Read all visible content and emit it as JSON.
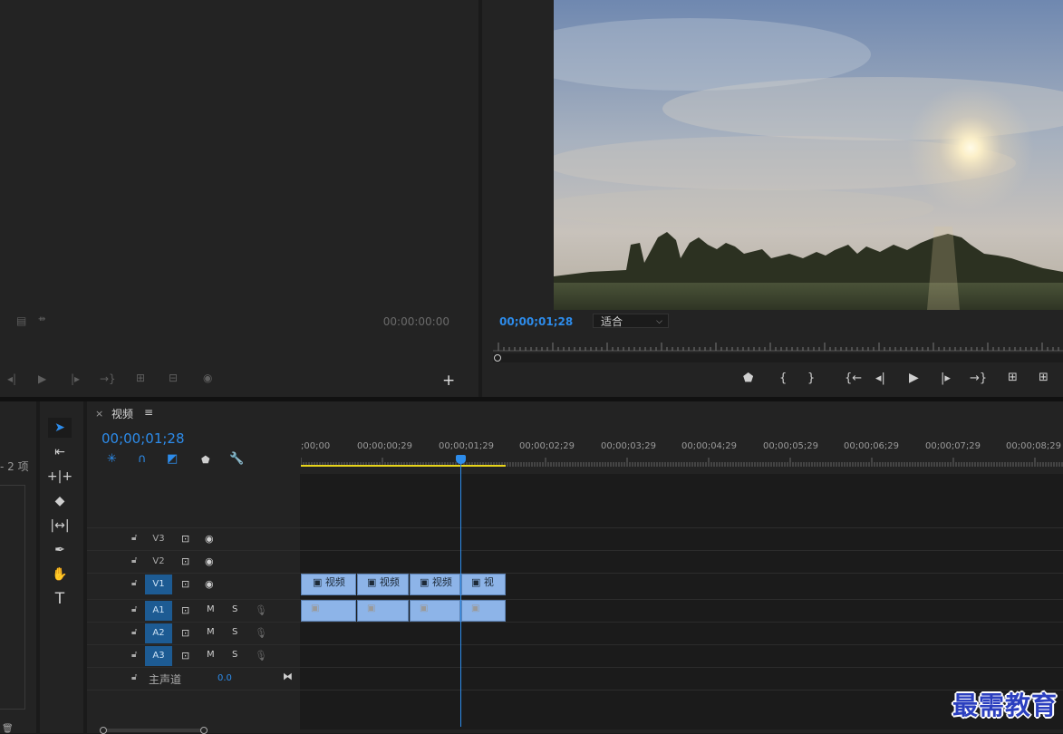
{
  "source_monitor": {
    "timecode": "00:00:00:00",
    "add_label": "+",
    "icons": [
      "marker-list-icon",
      "drag-icon",
      "step-back-icon",
      "play-icon",
      "step-forward-icon",
      "go-to-out-icon",
      "insert-icon",
      "overwrite-icon",
      "export-frame-icon"
    ]
  },
  "program_monitor": {
    "timecode": "00;00;01;28",
    "fit_value": "适合",
    "buttons": {
      "marker": "⬟",
      "in": "{",
      "out": "}",
      "go_in": "{←",
      "step_back": "◂|",
      "play": "▶",
      "step_fwd": "|▸",
      "go_out": "→}",
      "lift": "⊥",
      "extract": "⊥"
    }
  },
  "project": {
    "count_text": "- 2 项"
  },
  "tools": [
    "selection-tool",
    "track-select-tool",
    "ripple-edit-tool",
    "razor-tool",
    "slip-tool",
    "pen-tool",
    "hand-tool",
    "type-tool"
  ],
  "timeline": {
    "tab_close": "×",
    "tab_label": "视频",
    "tab_menu": "≡",
    "timecode": "00;00;01;28",
    "ruler": [
      ";00;00",
      "00;00;00;29",
      "00;00;01;29",
      "00;00;02;29",
      "00;00;03;29",
      "00;00;04;29",
      "00;00;05;29",
      "00;00;06;29",
      "00;00;07;29",
      "00;00;08;29"
    ],
    "tracks": {
      "v3": "V3",
      "v2": "V2",
      "v1": "V1",
      "a1": "A1",
      "a2": "A2",
      "a3": "A3",
      "mute": "M",
      "solo": "S",
      "master_label": "主声道",
      "master_value": "0.0"
    },
    "clips": [
      "视频",
      "视频",
      "视频",
      "视"
    ]
  },
  "watermark": "最需教育",
  "colors": {
    "accent": "#2d8ceb",
    "clip": "#8db4e8",
    "work_area": "#e7d41a",
    "track_on": "#1d5b93"
  }
}
